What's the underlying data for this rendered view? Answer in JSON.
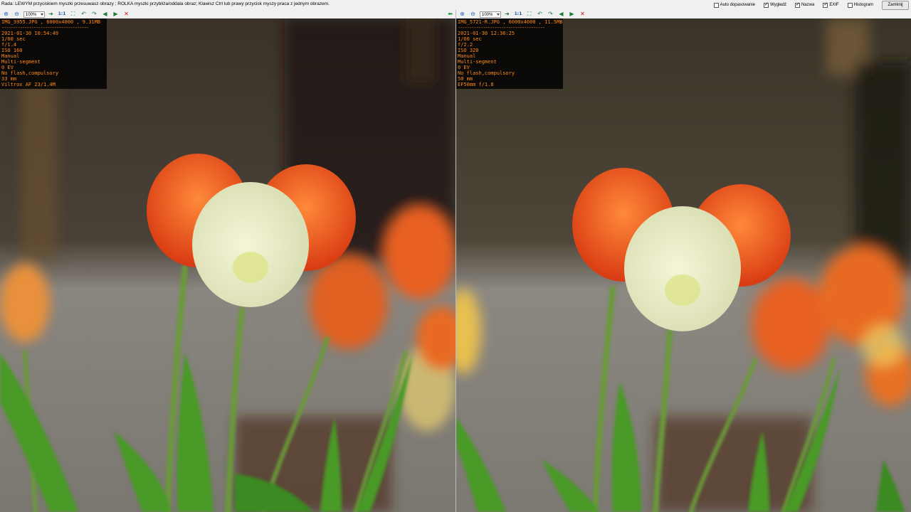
{
  "hint": "Rada: LEWYM przyciskiem myszki przesuwasz obrazy ; ROLKA myszki przybliża/oddala obraz; Klawisz Ctrl lub prawy przycisk myszy praca z jednym obrazem.",
  "options": [
    {
      "label": "Auto dopasowanie",
      "checked": false
    },
    {
      "label": "Wygładź",
      "checked": true
    },
    {
      "label": "Nazwa",
      "checked": true
    },
    {
      "label": "EXIF",
      "checked": true
    },
    {
      "label": "Histogram",
      "checked": false
    }
  ],
  "close_label": "Zamknij",
  "toolbar": {
    "zoom_value": "100%",
    "one_to_one": "1:1"
  },
  "left": {
    "header": "IMG_3955.JPG , 6000x4000 , 9.31MB",
    "separator": "--------------------------------------",
    "exif": [
      "2021-01-30 10:54:49",
      "1/60 sec",
      "f/1.4",
      "ISO 160",
      "Manual",
      "Multi-segment",
      "0 EV",
      "No flash,compulsory",
      "33 mm",
      "Viltrox AF 23/1.4M"
    ]
  },
  "right": {
    "header": "IMG_5721-R.JPG , 6000x4000 , 11.5MB",
    "separator": "--------------------------------------",
    "exif": [
      "2021-01-30 12:36:25",
      "1/60 sec",
      "f/2.2",
      "ISO 320",
      "Manual",
      "Multi-segment",
      "0 EV",
      "No flash,compulsory",
      "50 mm",
      "EF50mm f/1.8"
    ]
  },
  "icons": [
    "zoom-in-icon",
    "zoom-out-icon",
    "next-icon",
    "fit-icon",
    "rotate-left-icon",
    "rotate-right-icon",
    "prev-image-icon",
    "next-image-icon",
    "close-icon"
  ]
}
